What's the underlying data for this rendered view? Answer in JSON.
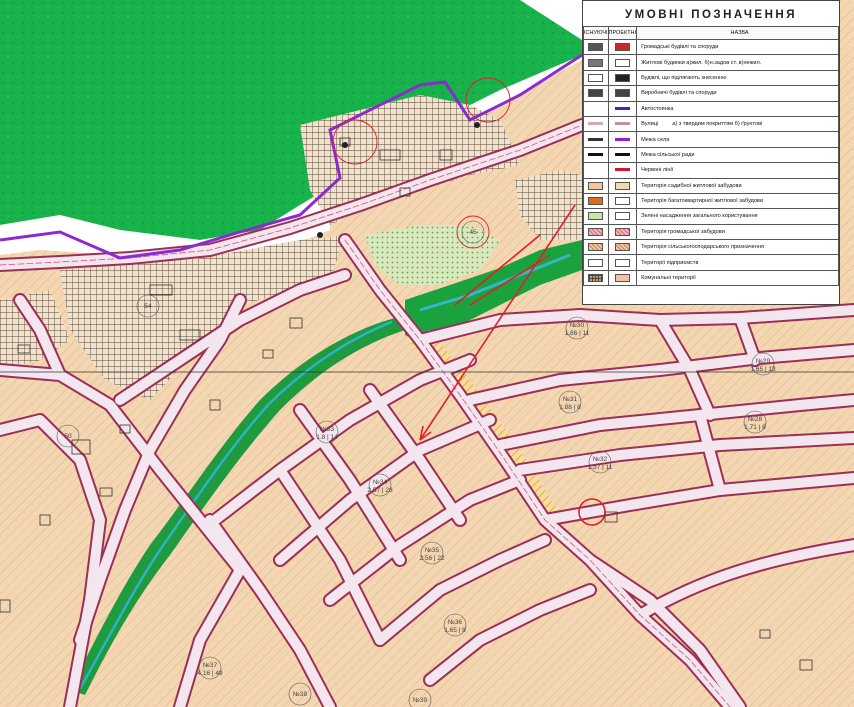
{
  "legend": {
    "title": "УМОВНІ ПОЗНАЧЕННЯ",
    "headers": [
      "ІСНУЮЧІ",
      "ПРОЕКТНІ",
      "НАЗВА"
    ],
    "rows": [
      {
        "key": "public-buildings",
        "label": "Громадські будівлі та споруди",
        "icon": "building-icon",
        "colors": [
          "#555555",
          "#cc2a2a"
        ]
      },
      {
        "key": "residential-buildings",
        "label": "Житлові будинки  а)жил. б)н.задов ст. в)нежил.",
        "icon": "house-icon",
        "colors": [
          "#777777",
          "#ffffff"
        ]
      },
      {
        "key": "demolish",
        "label": "Будівлі, що підлягають знесенню",
        "icon": "demolish-icon",
        "colors": [
          "#ffffff",
          "#222222"
        ]
      },
      {
        "key": "industrial",
        "label": "Виробничі будівлі та споруди",
        "icon": "factory-icon",
        "colors": [
          "#444444",
          "#444444"
        ]
      },
      {
        "key": "parking",
        "label": "Автостоянка",
        "icon": "parking-icon",
        "colors": [
          "#ffffff",
          "#2233cc"
        ]
      },
      {
        "key": "streets",
        "label": "а) з твердим покриттям  б) ґрунтові",
        "prefix": "Вулиці",
        "icon": "street-icon",
        "colors": [
          "#d4a8b8",
          "#c090b0"
        ]
      },
      {
        "key": "village-boundary",
        "label": "Межа села",
        "icon": "boundary-village-icon",
        "colors": [
          "#333333",
          "#9a1fd2"
        ]
      },
      {
        "key": "council-boundary",
        "label": "Межа сільської ради",
        "icon": "boundary-council-icon",
        "colors": [
          "#111111",
          "#111111"
        ]
      },
      {
        "key": "red-lines",
        "label": "Червоні лінії",
        "icon": "red-line-icon",
        "colors": [
          "#ffffff",
          "#d9152b"
        ]
      },
      {
        "key": "residential-estate",
        "label": "Територія садибної житлової забудови",
        "icon": "swatch-icon",
        "colors": [
          "#f0c89a",
          "#f3d9b0"
        ]
      },
      {
        "key": "multi-apartment",
        "label": "Територія багатоквартирної житлової забудови",
        "icon": "swatch-icon",
        "colors": [
          "#e06a1e",
          "#ffffff"
        ]
      },
      {
        "key": "green-public",
        "label": "Зелені насадження загального користування",
        "icon": "swatch-icon",
        "colors": [
          "#c9e6a3",
          "#ffffff"
        ]
      },
      {
        "key": "public-development",
        "label": "Територія громадської забудови",
        "icon": "swatch-icon",
        "colors": [
          "#f1b5be",
          "#f1b5be"
        ]
      },
      {
        "key": "agricultural",
        "label": "Територія сільськогосподарського призначення",
        "icon": "swatch-icon",
        "colors": [
          "#e9d48a",
          "#f1c99b"
        ]
      },
      {
        "key": "enterprises",
        "label": "Території підприємств",
        "icon": "swatch-icon",
        "colors": [
          "#ffffff",
          "#ffffff"
        ]
      },
      {
        "key": "communal",
        "label": "Комунальні території",
        "icon": "swatch-icon",
        "colors": [
          "#b7a08a",
          "#f2c1a6"
        ]
      }
    ]
  },
  "blocks": [
    {
      "id": "b30",
      "num": "№30",
      "val": "1.86 | 11"
    },
    {
      "id": "b29",
      "num": "№29",
      "val": "1.65 | 13"
    },
    {
      "id": "b28",
      "num": "№28",
      "val": "1.71 | 8"
    },
    {
      "id": "b31",
      "num": "№31",
      "val": "1.88 | 8"
    },
    {
      "id": "b32",
      "num": "№32",
      "val": "1.37 | 11"
    },
    {
      "id": "b33",
      "num": "№33",
      "val": "1.8 | 14"
    },
    {
      "id": "b34",
      "num": "№34",
      "val": "2.57 | 28"
    },
    {
      "id": "b35",
      "num": "№35",
      "val": "2.56 | 22"
    },
    {
      "id": "b36",
      "num": "№36",
      "val": "1.65 | 8"
    },
    {
      "id": "b37",
      "num": "№37",
      "val": "4.16 | 49"
    },
    {
      "id": "b38",
      "num": "№38",
      "val": ""
    },
    {
      "id": "b39",
      "num": "№39",
      "val": ""
    },
    {
      "id": "n50",
      "num": "50",
      "val": ""
    },
    {
      "id": "n45",
      "num": "45",
      "val": ""
    },
    {
      "id": "n54",
      "num": "54",
      "val": ""
    }
  ],
  "map": {
    "colors": {
      "forest": "#18b34a",
      "residential": "#f3d6b2",
      "hatch": "#e8b98c",
      "road_fill": "#efe1ea",
      "road_edge": "#9c2f55",
      "red_line": "#e0202a",
      "boundary": "#8a2ad1",
      "park": "#1aa23e",
      "water": "#35b7c9",
      "agri": "#f0c36a",
      "grid": "#5a4630"
    }
  }
}
